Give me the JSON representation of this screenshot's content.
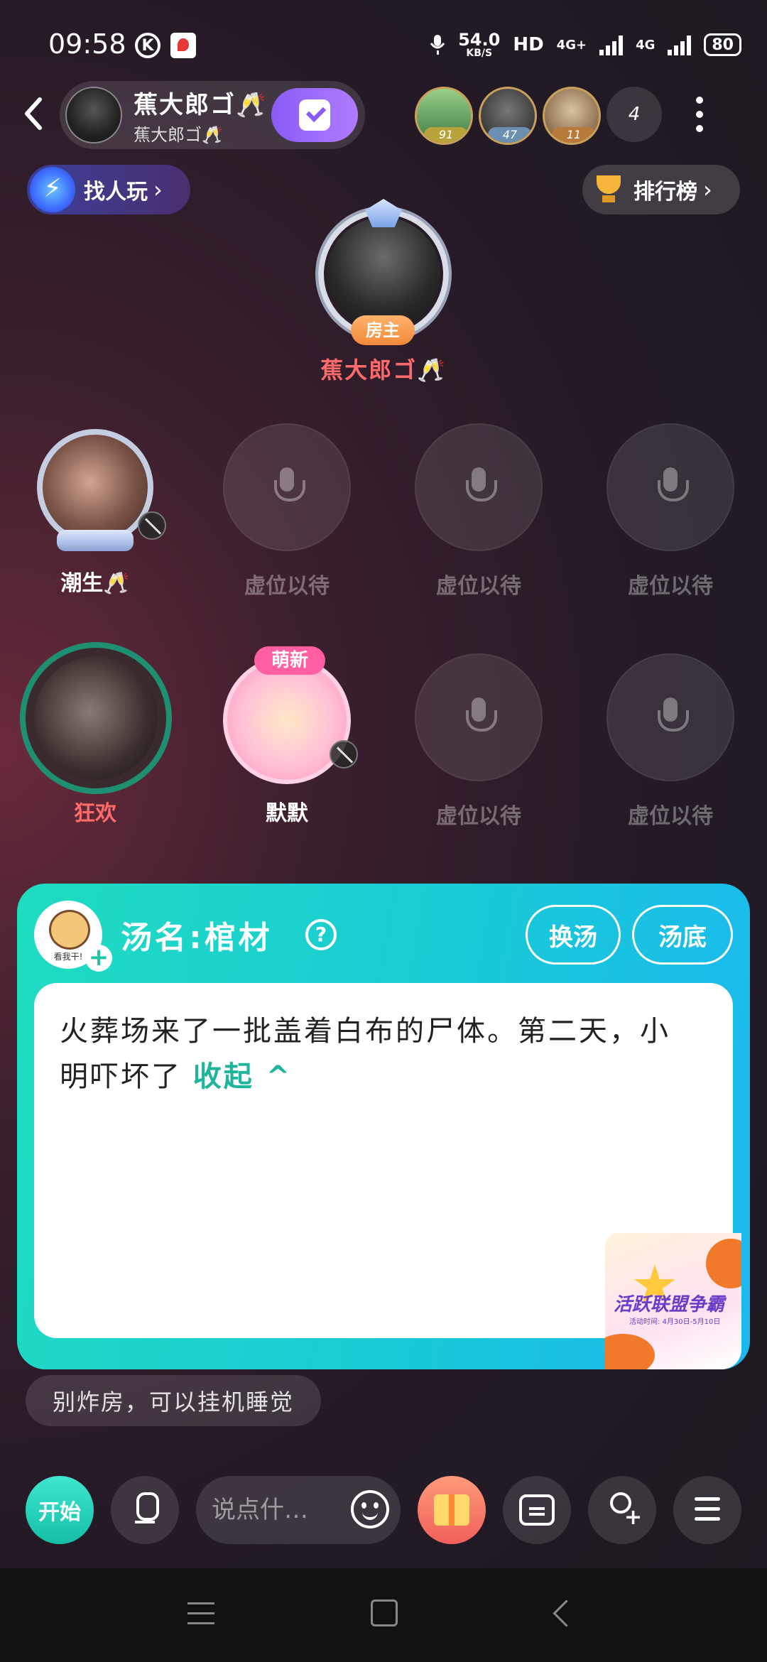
{
  "status_bar": {
    "time": "09:58",
    "k_label": "K",
    "net_speed_value": "54.0",
    "net_speed_unit": "KB/S",
    "hd_label": "HD",
    "net1": "4G+",
    "net2": "4G",
    "battery": "80"
  },
  "header": {
    "host_name": "蕉大郎ゴ🥂",
    "host_sub": "蕉大郎ゴ🥂",
    "viewers": [
      {
        "level": "91",
        "badge_color": "#b8a23a"
      },
      {
        "level": "47",
        "badge_color": "#6a8fb0"
      },
      {
        "level": "11",
        "badge_color": "#b87a3a"
      }
    ],
    "viewer_count": "4"
  },
  "sub_row": {
    "find_label": "找人玩",
    "rank_label": "排行榜"
  },
  "host_seat": {
    "tag": "房主",
    "name": "蕉大郎ゴ🥂"
  },
  "seats": [
    {
      "name": "潮生🥂",
      "empty": false
    },
    {
      "name": "虚位以待",
      "empty": true
    },
    {
      "name": "虚位以待",
      "empty": true
    },
    {
      "name": "虚位以待",
      "empty": true
    },
    {
      "name": "狂欢",
      "empty": false
    },
    {
      "name": "默默",
      "empty": false,
      "badge": "萌新"
    },
    {
      "name": "虚位以待",
      "empty": true
    },
    {
      "name": "虚位以待",
      "empty": true
    }
  ],
  "soup": {
    "avatar_text": "看我干!",
    "title": "汤名:棺材",
    "switch_label": "换汤",
    "answer_label": "汤底",
    "text": "火葬场来了一批盖着白布的尸体。第二天，小明吓坏了",
    "collapse_label": "收起 ^"
  },
  "event_banner": {
    "title": "活跃联盟争霸",
    "sub": "活动时间: 4月30日-5月10日"
  },
  "tip": "别炸房，可以挂机睡觉",
  "bottom_bar": {
    "start_label": "开始",
    "input_placeholder": "说点什…"
  },
  "colors": {
    "accent_teal": "#1fdcc0",
    "host_name_red": "#ff6a6a",
    "follow_purple": "#8a5cf6"
  }
}
